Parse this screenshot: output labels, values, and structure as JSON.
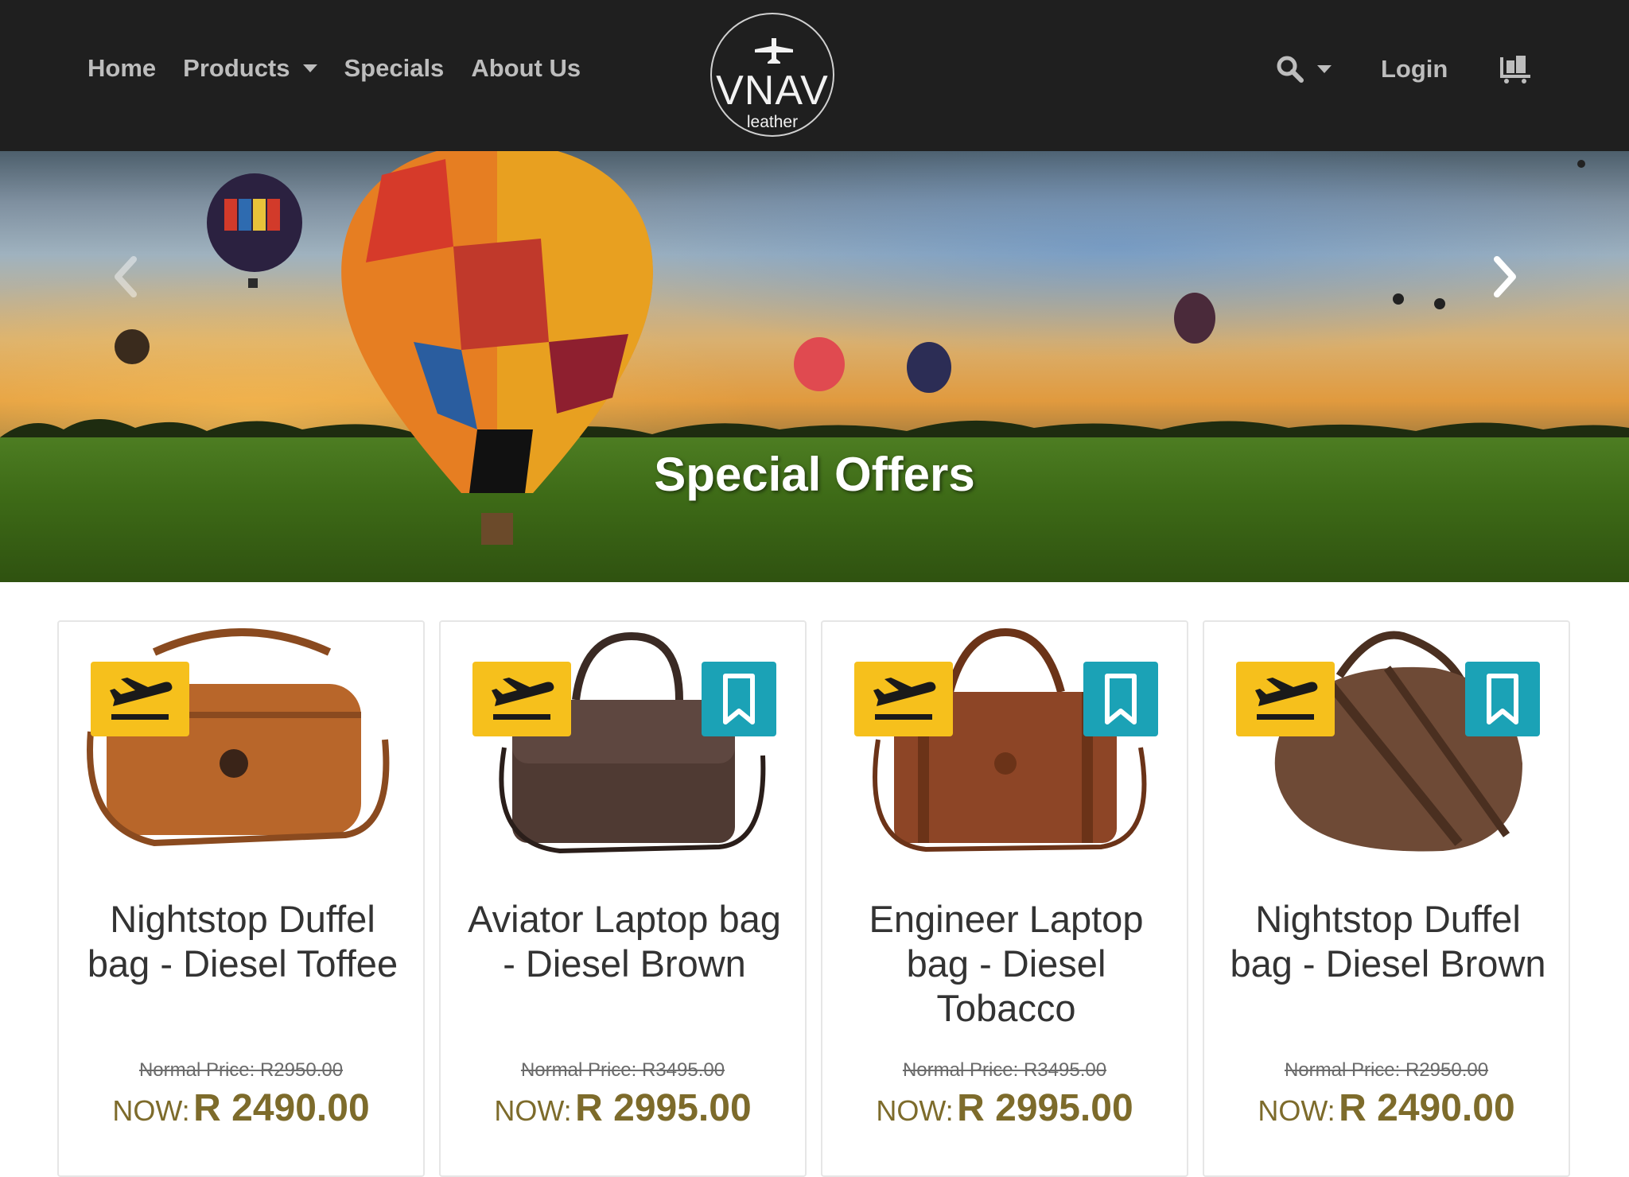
{
  "nav": {
    "home": "Home",
    "products": "Products",
    "specials": "Specials",
    "about": "About Us",
    "login": "Login"
  },
  "logo": {
    "name": "VNAV",
    "sub": "leather"
  },
  "hero": {
    "title": "Special Offers"
  },
  "products": [
    {
      "title": "Nightstop Duffel bag - Diesel Toffee",
      "normal_price": "Normal Price: R2950.00",
      "now_label": "NOW:",
      "now_price": "R 2490.00",
      "bag_color": "#b8662a"
    },
    {
      "title": "Aviator Laptop bag - Diesel Brown",
      "normal_price": "Normal Price: R3495.00",
      "now_label": "NOW:",
      "now_price": "R 2995.00",
      "bag_color": "#4f3a33"
    },
    {
      "title": "Engineer Laptop bag - Diesel Tobacco",
      "normal_price": "Normal Price: R3495.00",
      "now_label": "NOW:",
      "now_price": "R 2995.00",
      "bag_color": "#8d4526"
    },
    {
      "title": "Nightstop Duffel bag - Diesel Brown",
      "normal_price": "Normal Price: R2950.00",
      "now_label": "NOW:",
      "now_price": "R 2490.00",
      "bag_color": "#6e4a36"
    }
  ],
  "colors": {
    "navbar": "#1f1f1f",
    "flight_badge": "#f6c01c",
    "save_badge": "#1ba2b6",
    "price": "#7d6b2b"
  },
  "icons": [
    "plane-icon",
    "search-icon",
    "cart-icon",
    "chevron-left-icon",
    "chevron-right-icon",
    "flight-takeoff-icon",
    "bookmark-icon"
  ]
}
